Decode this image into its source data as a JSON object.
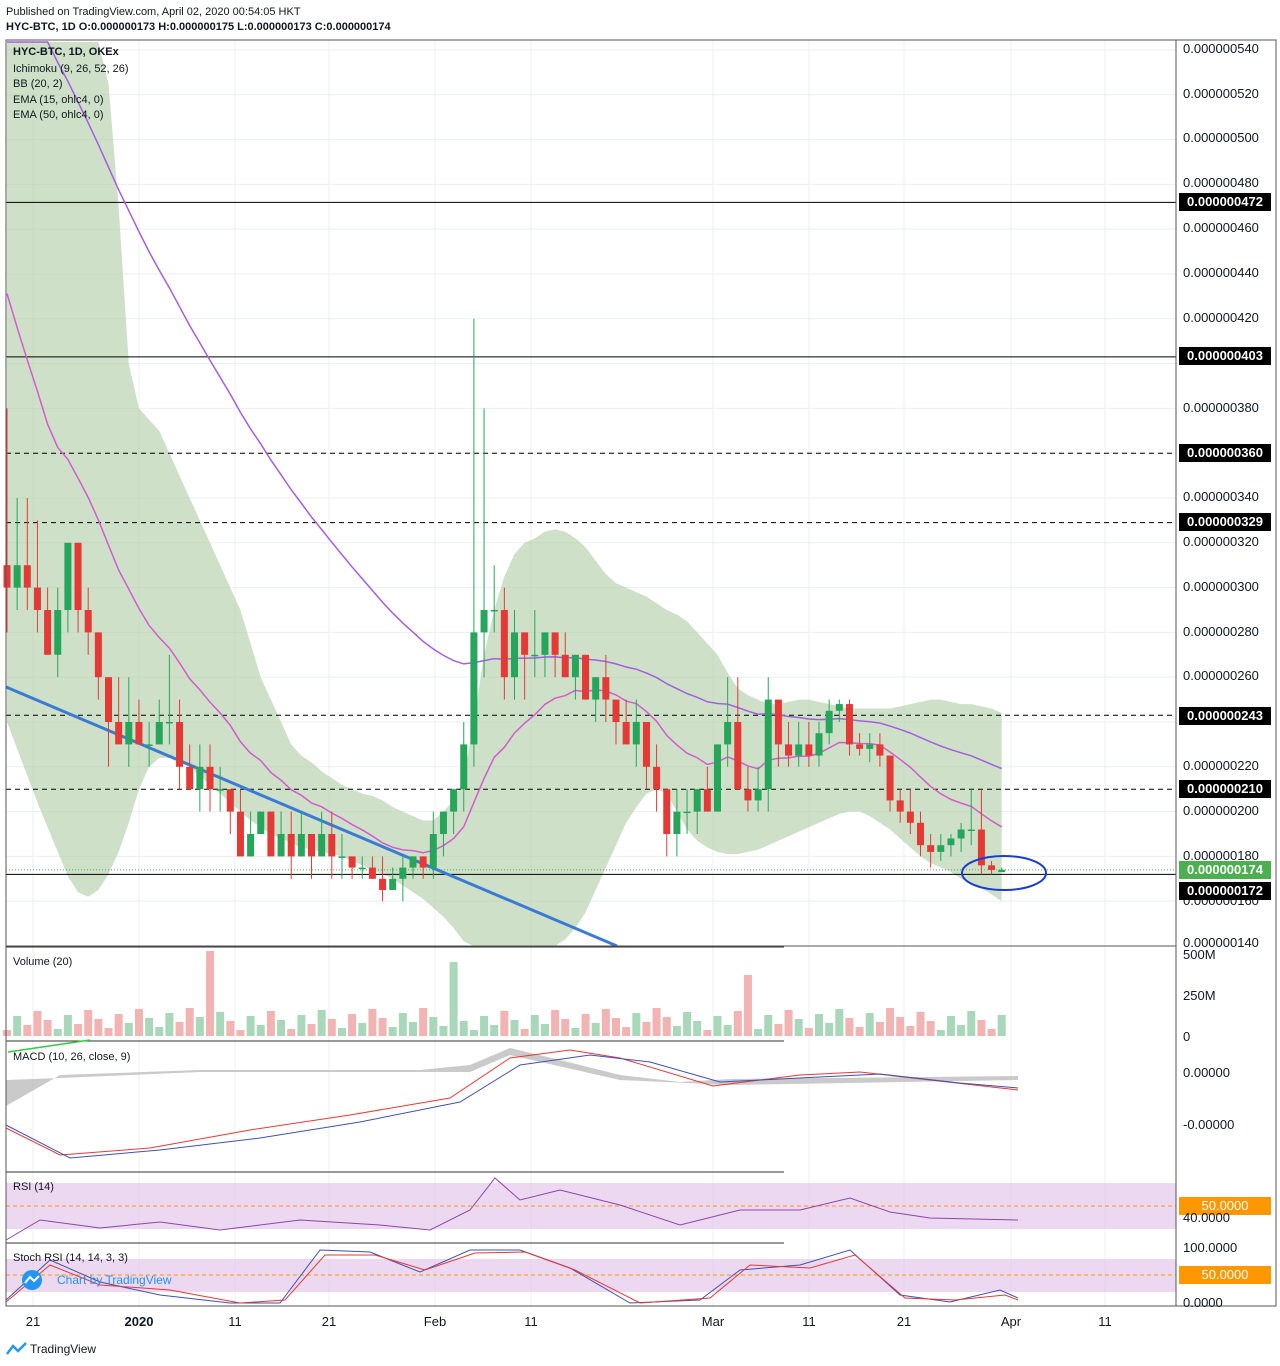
{
  "header": {
    "published": "Published on TradingView.com, April 02, 2020 00:54:05 HKT",
    "symbol_line": "HYC-BTC, 1D O:0.000000173 H:0.000000175 L:0.000000173 C:0.000000174"
  },
  "legend": {
    "symbol": "HYC-BTC, 1D, OKEx",
    "ichimoku": "Ichimoku (9, 26, 52, 26)",
    "bb": "BB (20, 2)",
    "ema15": "EMA (15, ohlc4, 0)",
    "ema50": "EMA (50, ohlc4, 0)"
  },
  "panes": {
    "volume": "Volume (20)",
    "macd": "MACD (10, 26, close, 9)",
    "rsi": "RSI (14)",
    "stoch": "Stoch RSI (14, 14, 3, 3)"
  },
  "price_axis": [
    "0.000000540",
    "0.000000520",
    "0.000000500",
    "0.000000480",
    "0.000000460",
    "0.000000440",
    "0.000000420",
    "0.000000380",
    "0.000000340",
    "0.000000320",
    "0.000000300",
    "0.000000280",
    "0.000000260",
    "0.000000220",
    "0.000000200",
    "0.000000180",
    "0.000000160",
    "0.000000140"
  ],
  "tags": {
    "l472": "0.000000472",
    "l403": "0.000000403",
    "l360": "0.000000360",
    "l329": "0.000000329",
    "l243": "0.000000243",
    "l210": "0.000000210",
    "last": "0.000000174",
    "l172": "0.000000172",
    "rsi_mid": "50.0000",
    "stoch_mid": "50.0000"
  },
  "volume_axis": [
    "500M",
    "250M",
    "0"
  ],
  "macd_axis": [
    "0.00000",
    "-0.00000"
  ],
  "rsi_axis": [
    "40.0000"
  ],
  "stoch_axis": [
    "100.0000",
    "0.0000"
  ],
  "x_axis": [
    "21",
    "2020",
    "11",
    "21",
    "Feb",
    "11",
    "Mar",
    "11",
    "21",
    "Apr",
    "11"
  ],
  "watermark": "Chart by TradingView",
  "footer": "TradingView",
  "colors": {
    "up": "#26a65b",
    "down": "#e53935",
    "cloud": "#a5c99a",
    "ema15": "#d55ad0",
    "ema50": "#a35ee0",
    "trend": "#3a7bd5",
    "circle": "#1a3ccf"
  },
  "chart_data": {
    "type": "candlestick",
    "title": "HYC-BTC, 1D, OKEx",
    "horizontal_levels": [
      4.72e-07,
      4.03e-07,
      3.6e-07,
      3.29e-07,
      2.43e-07,
      2.1e-07,
      1.72e-07
    ],
    "ylim": [
      1.4e-07,
      5.45e-07
    ],
    "candles": [
      [
        3.1e-07,
        3.8e-07,
        2.8e-07,
        3e-07
      ],
      [
        3e-07,
        3.4e-07,
        2.9e-07,
        3.1e-07
      ],
      [
        3.1e-07,
        3.4e-07,
        2.9e-07,
        3e-07
      ],
      [
        3e-07,
        3.3e-07,
        2.8e-07,
        2.9e-07
      ],
      [
        2.9e-07,
        3e-07,
        2.7e-07,
        2.7e-07
      ],
      [
        2.7e-07,
        3e-07,
        2.6e-07,
        2.9e-07
      ],
      [
        2.9e-07,
        3.2e-07,
        2.8e-07,
        3.2e-07
      ],
      [
        3.2e-07,
        3.2e-07,
        2.8e-07,
        2.9e-07
      ],
      [
        2.9e-07,
        3e-07,
        2.7e-07,
        2.8e-07
      ],
      [
        2.8e-07,
        2.8e-07,
        2.5e-07,
        2.6e-07
      ],
      [
        2.6e-07,
        2.6e-07,
        2.2e-07,
        2.4e-07
      ],
      [
        2.4e-07,
        2.6e-07,
        2.3e-07,
        2.3e-07
      ],
      [
        2.3e-07,
        2.6e-07,
        2.2e-07,
        2.4e-07
      ],
      [
        2.4e-07,
        2.5e-07,
        2.3e-07,
        2.3e-07
      ],
      [
        2.3e-07,
        2.4e-07,
        2.2e-07,
        2.3e-07
      ],
      [
        2.3e-07,
        2.5e-07,
        2.3e-07,
        2.4e-07
      ],
      [
        2.4e-07,
        2.7e-07,
        2.3e-07,
        2.4e-07
      ],
      [
        2.4e-07,
        2.5e-07,
        2.1e-07,
        2.2e-07
      ],
      [
        2.2e-07,
        2.3e-07,
        2.1e-07,
        2.1e-07
      ],
      [
        2.1e-07,
        2.3e-07,
        2e-07,
        2.2e-07
      ],
      [
        2.2e-07,
        2.3e-07,
        2e-07,
        2.1e-07
      ],
      [
        2.1e-07,
        2.2e-07,
        2e-07,
        2.1e-07
      ],
      [
        2.1e-07,
        2.1e-07,
        1.9e-07,
        2e-07
      ],
      [
        2e-07,
        2.1e-07,
        1.8e-07,
        1.8e-07
      ],
      [
        1.8e-07,
        2e-07,
        1.8e-07,
        1.9e-07
      ],
      [
        1.9e-07,
        2e-07,
        1.9e-07,
        2e-07
      ],
      [
        2e-07,
        2e-07,
        1.8e-07,
        1.8e-07
      ],
      [
        1.8e-07,
        2e-07,
        1.8e-07,
        1.9e-07
      ],
      [
        1.9e-07,
        2e-07,
        1.7e-07,
        1.8e-07
      ],
      [
        1.8e-07,
        2e-07,
        1.8e-07,
        1.9e-07
      ],
      [
        1.9e-07,
        1.9e-07,
        1.7e-07,
        1.8e-07
      ],
      [
        1.8e-07,
        2e-07,
        1.8e-07,
        1.9e-07
      ],
      [
        1.9e-07,
        2e-07,
        1.7e-07,
        1.8e-07
      ],
      [
        1.8e-07,
        1.9e-07,
        1.7e-07,
        1.8e-07
      ],
      [
        1.8e-07,
        1.8e-07,
        1.7e-07,
        1.75e-07
      ],
      [
        1.75e-07,
        1.8e-07,
        1.7e-07,
        1.75e-07
      ],
      [
        1.75e-07,
        1.8e-07,
        1.7e-07,
        1.7e-07
      ],
      [
        1.7e-07,
        1.8e-07,
        1.6e-07,
        1.65e-07
      ],
      [
        1.65e-07,
        1.75e-07,
        1.65e-07,
        1.7e-07
      ],
      [
        1.7e-07,
        1.8e-07,
        1.6e-07,
        1.75e-07
      ],
      [
        1.75e-07,
        1.8e-07,
        1.7e-07,
        1.8e-07
      ],
      [
        1.8e-07,
        1.8e-07,
        1.7e-07,
        1.75e-07
      ],
      [
        1.75e-07,
        2e-07,
        1.7e-07,
        1.9e-07
      ],
      [
        1.9e-07,
        2e-07,
        1.8e-07,
        2e-07
      ],
      [
        2e-07,
        2.1e-07,
        1.9e-07,
        2.1e-07
      ],
      [
        2.1e-07,
        2.4e-07,
        2e-07,
        2.3e-07
      ],
      [
        2.3e-07,
        4.2e-07,
        2.2e-07,
        2.8e-07
      ],
      [
        2.8e-07,
        3.8e-07,
        2.6e-07,
        2.9e-07
      ],
      [
        2.9e-07,
        3.1e-07,
        2.8e-07,
        2.9e-07
      ],
      [
        2.9e-07,
        3e-07,
        2.5e-07,
        2.6e-07
      ],
      [
        2.6e-07,
        2.9e-07,
        2.5e-07,
        2.8e-07
      ],
      [
        2.8e-07,
        2.8e-07,
        2.5e-07,
        2.7e-07
      ],
      [
        2.7e-07,
        2.9e-07,
        2.6e-07,
        2.7e-07
      ],
      [
        2.7e-07,
        2.8e-07,
        2.6e-07,
        2.8e-07
      ],
      [
        2.8e-07,
        2.8e-07,
        2.6e-07,
        2.7e-07
      ],
      [
        2.7e-07,
        2.8e-07,
        2.6e-07,
        2.6e-07
      ],
      [
        2.6e-07,
        2.7e-07,
        2.5e-07,
        2.7e-07
      ],
      [
        2.7e-07,
        2.7e-07,
        2.5e-07,
        2.5e-07
      ],
      [
        2.5e-07,
        2.6e-07,
        2.4e-07,
        2.6e-07
      ],
      [
        2.6e-07,
        2.7e-07,
        2.4e-07,
        2.5e-07
      ],
      [
        2.5e-07,
        2.5e-07,
        2.3e-07,
        2.4e-07
      ],
      [
        2.4e-07,
        2.5e-07,
        2.3e-07,
        2.3e-07
      ],
      [
        2.3e-07,
        2.5e-07,
        2.2e-07,
        2.4e-07
      ],
      [
        2.4e-07,
        2.4e-07,
        2.1e-07,
        2.2e-07
      ],
      [
        2.2e-07,
        2.3e-07,
        2e-07,
        2.1e-07
      ],
      [
        2.1e-07,
        2.1e-07,
        1.8e-07,
        1.9e-07
      ],
      [
        1.9e-07,
        2.1e-07,
        1.8e-07,
        2e-07
      ],
      [
        2e-07,
        2.1e-07,
        1.9e-07,
        2e-07
      ],
      [
        2e-07,
        2.1e-07,
        1.9e-07,
        2.1e-07
      ],
      [
        2.1e-07,
        2.2e-07,
        2e-07,
        2e-07
      ],
      [
        2e-07,
        2.3e-07,
        2e-07,
        2.3e-07
      ],
      [
        2.3e-07,
        2.6e-07,
        2.2e-07,
        2.4e-07
      ],
      [
        2.4e-07,
        2.6e-07,
        2.1e-07,
        2.1e-07
      ],
      [
        2.1e-07,
        2.2e-07,
        2e-07,
        2.05e-07
      ],
      [
        2.05e-07,
        2.2e-07,
        2e-07,
        2.1e-07
      ],
      [
        2.1e-07,
        2.6e-07,
        2e-07,
        2.5e-07
      ],
      [
        2.5e-07,
        2.5e-07,
        2.2e-07,
        2.3e-07
      ],
      [
        2.3e-07,
        2.4e-07,
        2.2e-07,
        2.25e-07
      ],
      [
        2.25e-07,
        2.4e-07,
        2.2e-07,
        2.3e-07
      ],
      [
        2.3e-07,
        2.4e-07,
        2.2e-07,
        2.25e-07
      ],
      [
        2.25e-07,
        2.4e-07,
        2.2e-07,
        2.35e-07
      ],
      [
        2.35e-07,
        2.5e-07,
        2.3e-07,
        2.45e-07
      ],
      [
        2.45e-07,
        2.5e-07,
        2.4e-07,
        2.48e-07
      ],
      [
        2.48e-07,
        2.5e-07,
        2.25e-07,
        2.3e-07
      ],
      [
        2.3e-07,
        2.35e-07,
        2.25e-07,
        2.28e-07
      ],
      [
        2.28e-07,
        2.35e-07,
        2.22e-07,
        2.3e-07
      ],
      [
        2.3e-07,
        2.35e-07,
        2.2e-07,
        2.25e-07
      ],
      [
        2.25e-07,
        2.25e-07,
        2e-07,
        2.05e-07
      ],
      [
        2.05e-07,
        2.1e-07,
        1.95e-07,
        2e-07
      ],
      [
        2e-07,
        2.1e-07,
        1.9e-07,
        1.95e-07
      ],
      [
        1.95e-07,
        2e-07,
        1.8e-07,
        1.85e-07
      ],
      [
        1.85e-07,
        1.9e-07,
        1.75e-07,
        1.82e-07
      ],
      [
        1.82e-07,
        1.9e-07,
        1.78e-07,
        1.85e-07
      ],
      [
        1.85e-07,
        1.9e-07,
        1.8e-07,
        1.88e-07
      ],
      [
        1.88e-07,
        1.95e-07,
        1.82e-07,
        1.92e-07
      ],
      [
        1.92e-07,
        2.1e-07,
        1.85e-07,
        1.92e-07
      ],
      [
        1.92e-07,
        2.1e-07,
        1.72e-07,
        1.76e-07
      ],
      [
        1.76e-07,
        1.78e-07,
        1.72e-07,
        1.74e-07
      ],
      [
        1.73e-07,
        1.75e-07,
        1.73e-07,
        1.74e-07
      ]
    ]
  }
}
